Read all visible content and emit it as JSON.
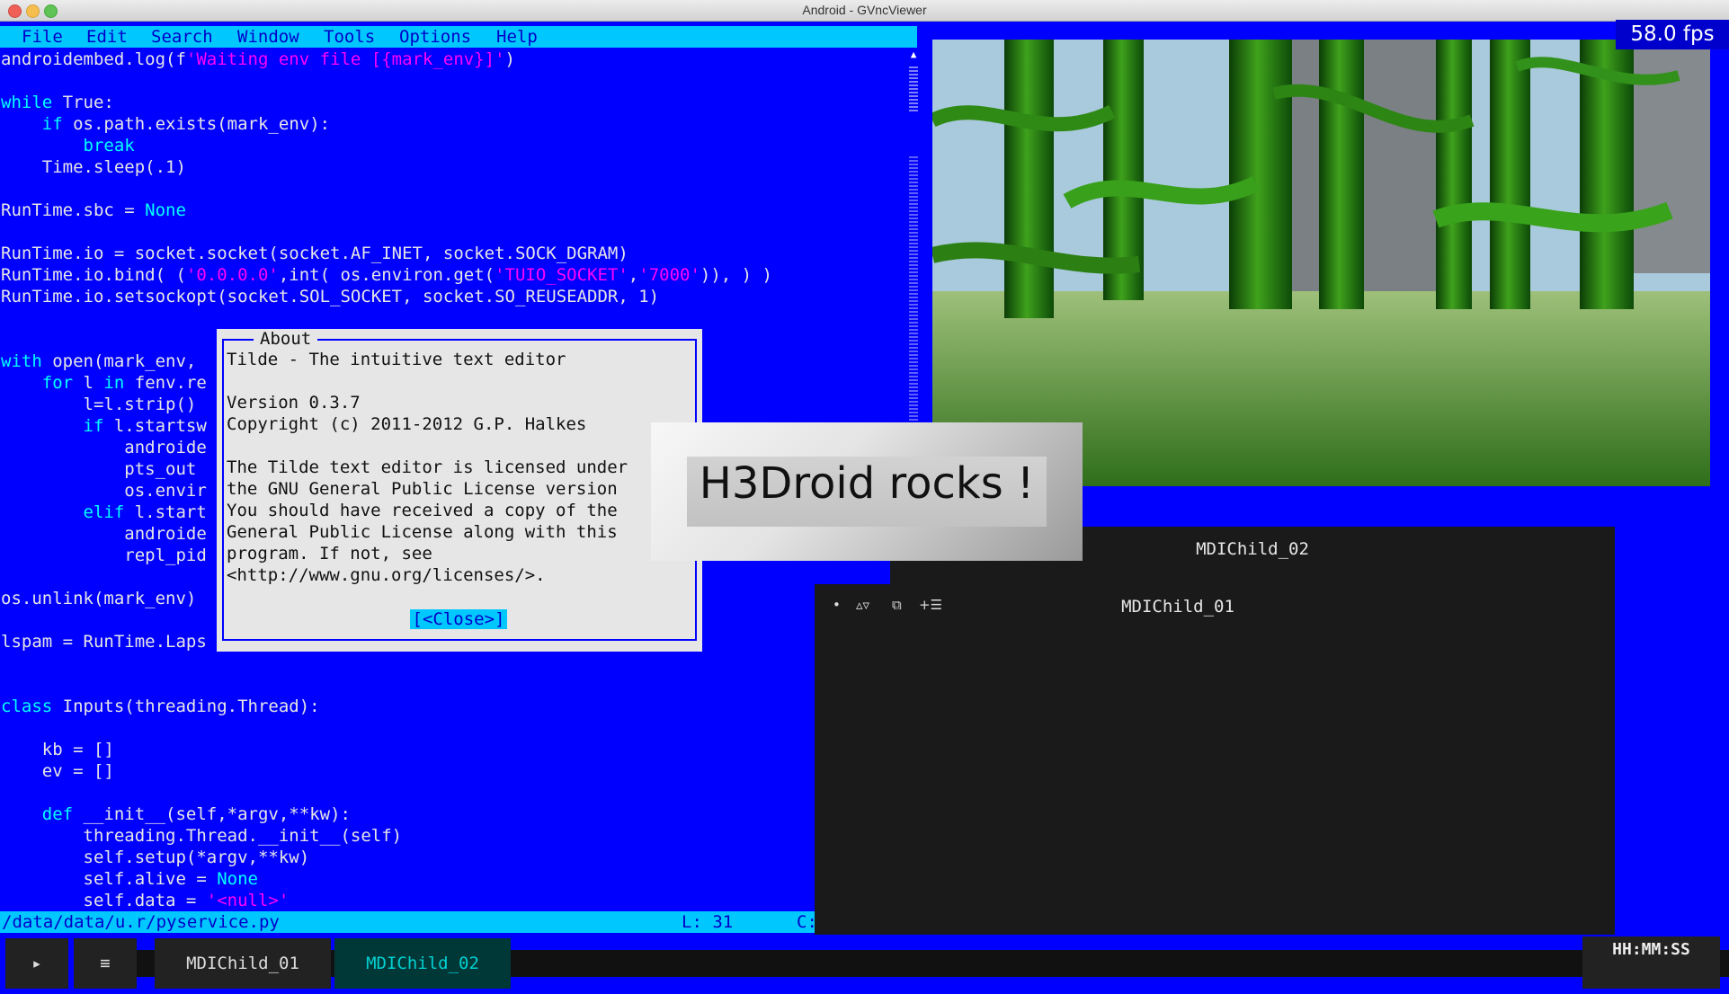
{
  "window": {
    "title": "Android - GVncViewer"
  },
  "editor": {
    "menu": [
      "File",
      "Edit",
      "Search",
      "Window",
      "Tools",
      "Options",
      "Help"
    ],
    "status": {
      "path": "/data/data/u.r/pyservice.py",
      "line": "L: 31",
      "col": "C: 3"
    }
  },
  "about": {
    "title": "About",
    "lines": [
      "Tilde - The intuitive text editor",
      "",
      "Version 0.3.7",
      "Copyright (c) 2011-2012 G.P. Halkes",
      "",
      "The Tilde text editor is licensed under",
      "the GNU General Public License version",
      "You should have received a copy of the",
      "General Public License along with this",
      "program. If not, see",
      "<http://www.gnu.org/licenses/>."
    ],
    "close_label": "[<Close>]"
  },
  "scene": {
    "fps": "58.0 fps"
  },
  "banner": {
    "text": "H3Droid rocks !"
  },
  "mdi": {
    "child2": {
      "title": "MDIChild_02",
      "controls": [
        "•",
        "▵▿",
        "⧉",
        "+☰"
      ]
    },
    "child1": {
      "title": "MDIChild_01",
      "controls": [
        "•",
        "▵▿",
        "⧉",
        "+☰"
      ]
    }
  },
  "taskbar": {
    "play": "▸",
    "menu": "≡",
    "task1": "MDIChild_01",
    "task2": "MDIChild_02",
    "clock": "HH:MM:SS"
  },
  "colors": {
    "editor_bg": "#0000ff",
    "menubar": "#00c8ff",
    "keyword": "#00ffff",
    "string": "#ff00ff"
  }
}
